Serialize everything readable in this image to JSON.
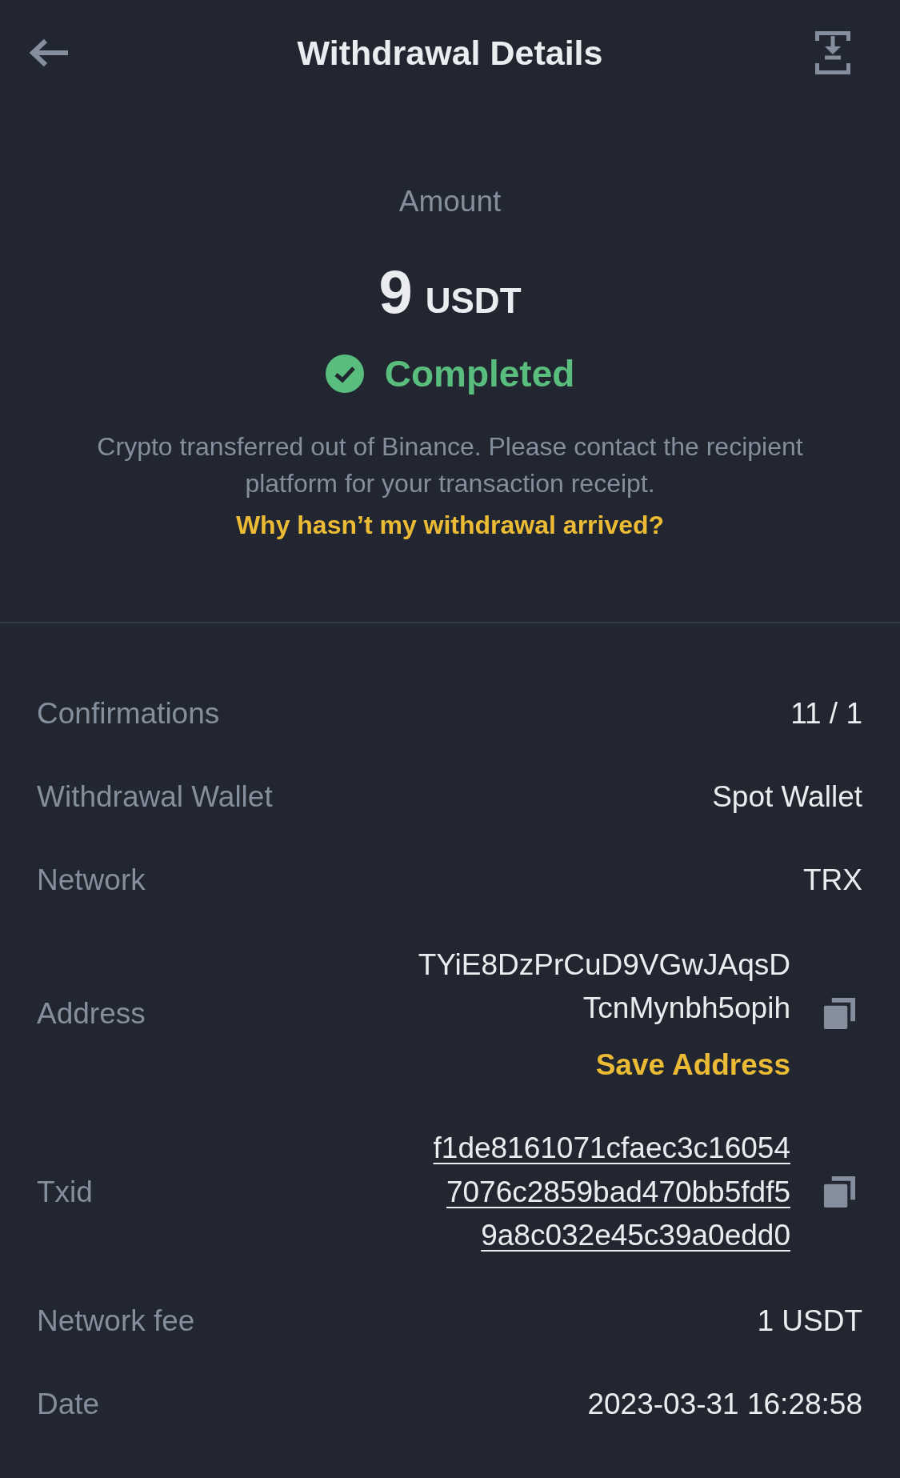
{
  "header": {
    "title": "Withdrawal Details"
  },
  "amount": {
    "label": "Amount",
    "value": "9",
    "unit": "USDT"
  },
  "status": {
    "kind": "success",
    "label": "Completed"
  },
  "notice": {
    "text": "Crypto transferred out of Binance. Please contact the recipient platform for your transaction receipt.",
    "link": "Why hasn’t my withdrawal arrived?"
  },
  "details": [
    {
      "kind": "text",
      "label": "Confirmations",
      "value": "11 / 1"
    },
    {
      "kind": "text",
      "label": "Withdrawal Wallet",
      "value": "Spot Wallet"
    },
    {
      "kind": "text",
      "label": "Network",
      "value": "TRX"
    },
    {
      "kind": "address",
      "label": "Address",
      "value_lines": [
        "TYiE8DzPrCuD9VGwJAqsD",
        "TcnMynbh5opih"
      ],
      "action": "Save Address"
    },
    {
      "kind": "txid",
      "label": "Txid",
      "value_lines": [
        "f1de8161071cfaec3c16054",
        "7076c2859bad470bb5fdf5",
        "9a8c032e45c39a0edd0"
      ]
    },
    {
      "kind": "text",
      "label": "Network fee",
      "value": "1 USDT"
    },
    {
      "kind": "text",
      "label": "Date",
      "value": "2023-03-31 16:28:58"
    }
  ]
}
